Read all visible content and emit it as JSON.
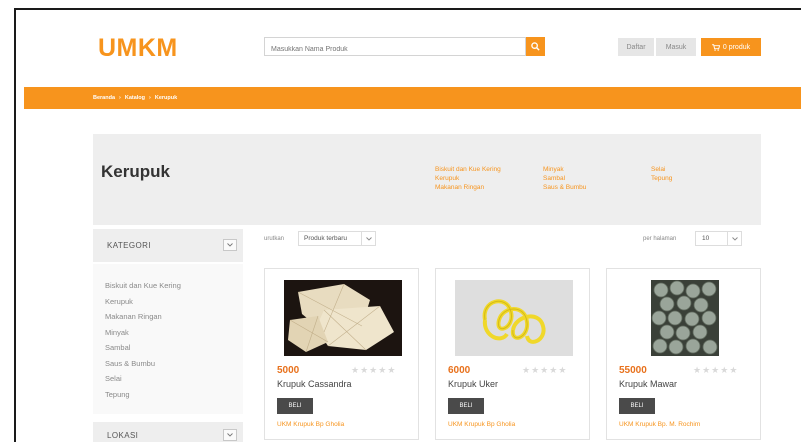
{
  "header": {
    "logo": "UMKM",
    "search_placeholder": "Masukkan Nama Produk",
    "daftar_label": "Daftar",
    "masuk_label": "Masuk",
    "cart_label": "0 produk"
  },
  "breadcrumb": {
    "items": [
      "Beranda",
      "Katalog",
      "Kerupuk"
    ],
    "separator": "›"
  },
  "category": {
    "title": "Kerupuk",
    "links_col1": [
      "Biskuit dan Kue Kering",
      "Kerupuk",
      "Makanan Ringan"
    ],
    "links_col2": [
      "Minyak",
      "Sambal",
      "Saus & Bumbu"
    ],
    "links_col3": [
      "Selai",
      "Tepung"
    ]
  },
  "sidebar": {
    "kategori_title": "KATEGORI",
    "items": [
      "Biskuit dan Kue Kering",
      "Kerupuk",
      "Makanan Ringan",
      "Minyak",
      "Sambal",
      "Saus & Bumbu",
      "Selai",
      "Tepung"
    ],
    "lokasi_title": "LOKASI"
  },
  "toolbar": {
    "sort_label": "urutkan",
    "sort_value": "Produk terbaru",
    "perpage_label": "per halaman",
    "perpage_value": "10"
  },
  "products": [
    {
      "price": "5000",
      "name": "Krupuk Cassandra",
      "buy_label": "BELI",
      "seller": "UKM Krupuk Bp Gholia",
      "rating": 0
    },
    {
      "price": "6000",
      "name": "Krupuk Uker",
      "buy_label": "BELI",
      "seller": "UKM Krupuk Bp Gholia",
      "rating": 0
    },
    {
      "price": "55000",
      "name": "Krupuk Mawar",
      "buy_label": "BELI",
      "seller": "UKM Krupuk Bp. M. Rochim",
      "rating": 0
    }
  ],
  "colors": {
    "accent": "#f7941d",
    "price": "#e8711c",
    "panel": "#eeeeee",
    "buy_button": "#4a4a4a"
  },
  "icons": {
    "search": "search-icon",
    "cart": "cart-icon",
    "chevron": "chevron-down-icon",
    "star": "star-icon"
  }
}
